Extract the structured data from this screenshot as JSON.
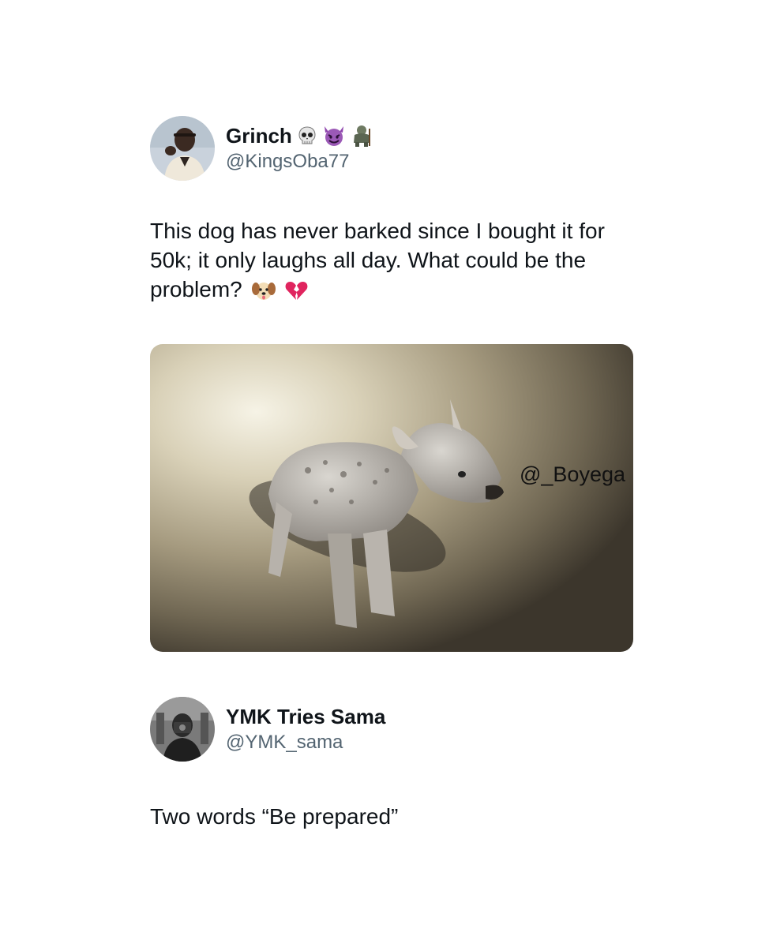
{
  "tweets": [
    {
      "display_name": "Grinch",
      "name_emojis": [
        "skull-icon",
        "smiling-devil-icon",
        "troll-icon"
      ],
      "handle": "@KingsOba77",
      "text": "This dog has never barked since I bought it for 50k; it only laughs all day. What could be the problem?",
      "text_emojis": [
        "dog-face-icon",
        "broken-heart-icon"
      ],
      "media_watermark": "@_Boyega"
    },
    {
      "display_name": "YMK Tries Sama",
      "handle": "@YMK_sama",
      "text": "Two words “Be prepared”"
    }
  ],
  "colors": {
    "text": "#0f1419",
    "handle": "#536471",
    "background": "#ffffff"
  }
}
